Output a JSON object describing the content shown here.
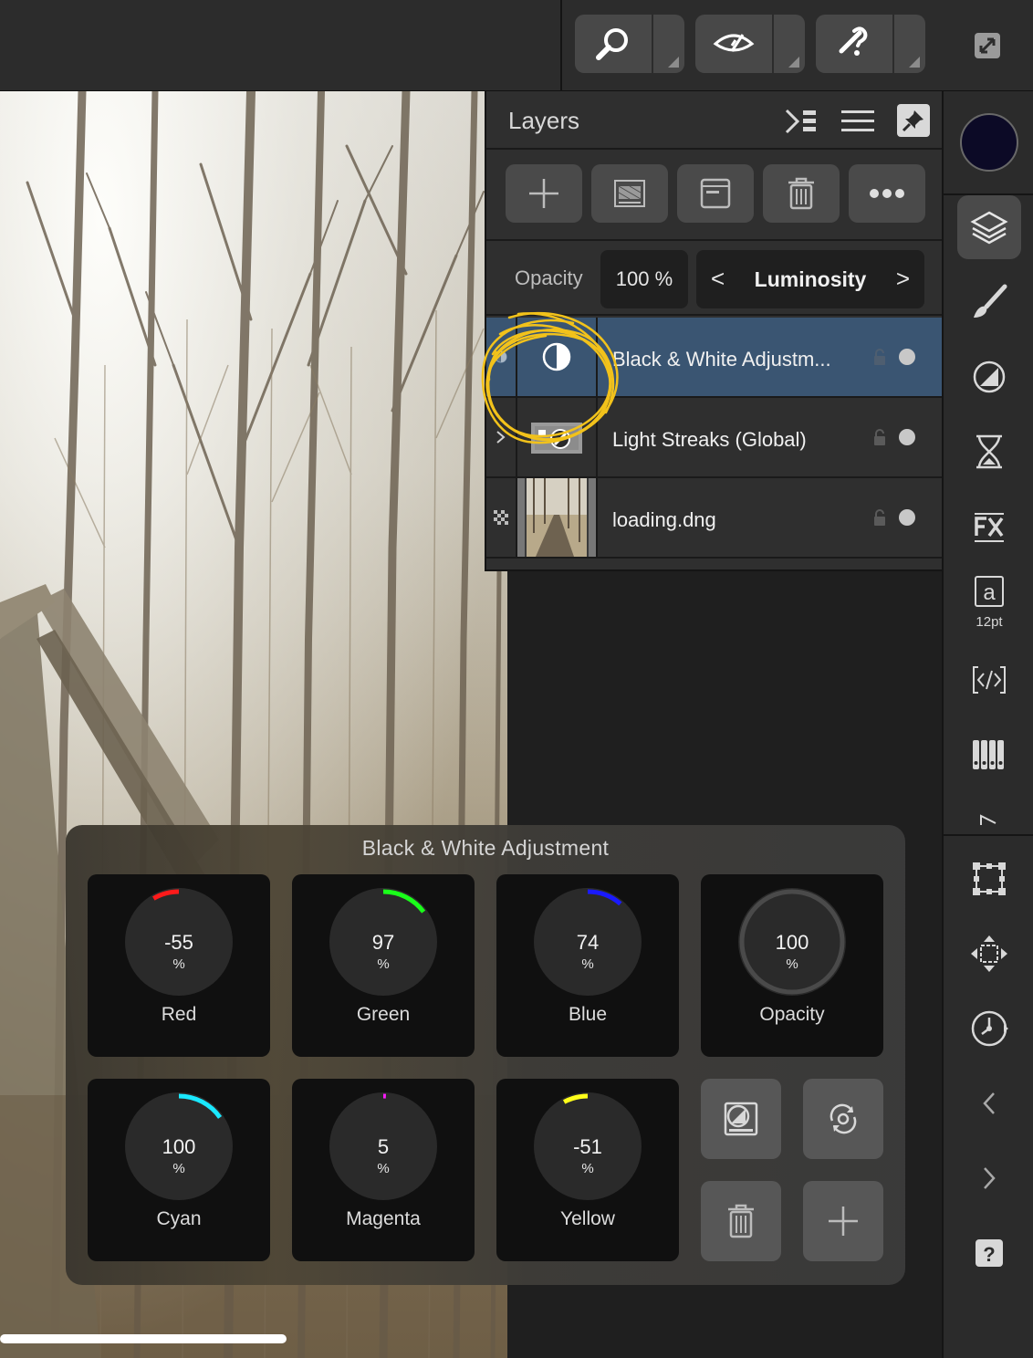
{
  "toolbar": {
    "tools": [
      {
        "icon": "zoom-icon"
      },
      {
        "icon": "view-mode-icon"
      },
      {
        "icon": "assistant-icon"
      }
    ],
    "fullscreen_icon": "fullscreen-icon"
  },
  "layers_panel": {
    "title": "Layers",
    "opacity_label": "Opacity",
    "opacity_value": "100 %",
    "blend_mode": "Luminosity",
    "layers": [
      {
        "name": "Black & White Adjustm...",
        "selected": true,
        "type": "adjustment"
      },
      {
        "name": "Light Streaks (Global)",
        "selected": false,
        "type": "live-filter"
      },
      {
        "name": "loading.dng",
        "selected": false,
        "type": "pixel"
      }
    ]
  },
  "right_toolbar": {
    "text_size": "12pt"
  },
  "adjustment": {
    "title": "Black & White Adjustment",
    "unit": "%",
    "dials": [
      {
        "label": "Red",
        "value": "-55",
        "color": "#ff1a1a"
      },
      {
        "label": "Green",
        "value": "97",
        "color": "#1aff1a"
      },
      {
        "label": "Blue",
        "value": "74",
        "color": "#1a1aff"
      },
      {
        "label": "Opacity",
        "value": "100",
        "color": "#4a4a4a"
      },
      {
        "label": "Cyan",
        "value": "100",
        "color": "#1ae8ff"
      },
      {
        "label": "Magenta",
        "value": "5",
        "color": "#ff1aff"
      },
      {
        "label": "Yellow",
        "value": "-51",
        "color": "#ffff1a"
      }
    ]
  },
  "colors": {
    "accent_selected_row": "#3a5572",
    "annotation": "#f2c21b",
    "current_color": "#0c0a26"
  }
}
